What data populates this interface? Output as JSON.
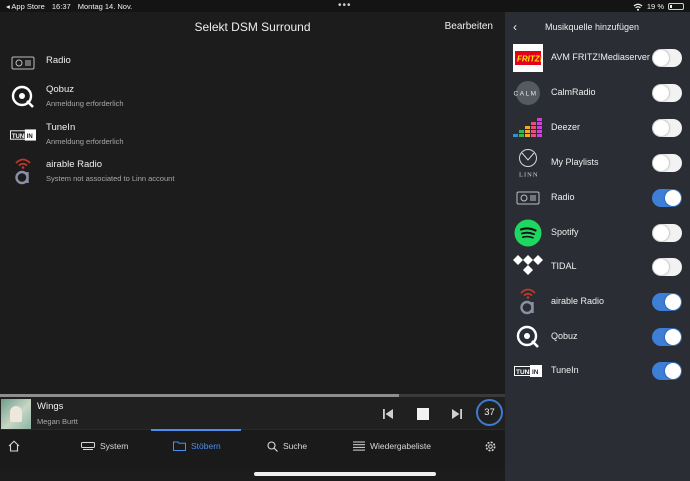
{
  "status_bar": {
    "back_app": "◂ App Store",
    "time": "16:37",
    "date": "Montag 14. Nov.",
    "battery": "19 %",
    "battery_level": 0.19
  },
  "main": {
    "title": "Selekt DSM Surround",
    "edit_label": "Bearbeiten",
    "sources": [
      {
        "name": "Radio",
        "subtitle": "",
        "icon": "radio-icon"
      },
      {
        "name": "Qobuz",
        "subtitle": "Anmeldung erforderlich",
        "icon": "qobuz-icon"
      },
      {
        "name": "TuneIn",
        "subtitle": "Anmeldung erforderlich",
        "icon": "tunein-icon"
      },
      {
        "name": "airable Radio",
        "subtitle": "System not associated to Linn account",
        "icon": "airable-icon"
      }
    ]
  },
  "player": {
    "track": "Wings",
    "artist": "Megan Burtt",
    "volume": "37",
    "progress": 0.79
  },
  "tabs": [
    {
      "label": "",
      "icon": "home-icon"
    },
    {
      "label": "System",
      "icon": "system-icon"
    },
    {
      "label": "Stöbern",
      "icon": "browse-icon",
      "active": true
    },
    {
      "label": "Suche",
      "icon": "search-icon"
    },
    {
      "label": "Wiedergabeliste",
      "icon": "playlist-icon"
    },
    {
      "label": "",
      "icon": "gear-icon"
    }
  ],
  "sidebar": {
    "back": "‹",
    "title": "Musikquelle hinzufügen",
    "items": [
      {
        "label": "AVM FRITZ!Mediaserver",
        "enabled": false,
        "icon": "fritz-icon"
      },
      {
        "label": "CalmRadio",
        "enabled": false,
        "icon": "calm-icon"
      },
      {
        "label": "Deezer",
        "enabled": false,
        "icon": "deezer-icon"
      },
      {
        "label": "My Playlists",
        "enabled": false,
        "icon": "linn-icon"
      },
      {
        "label": "Radio",
        "enabled": true,
        "icon": "radio-icon"
      },
      {
        "label": "Spotify",
        "enabled": false,
        "icon": "spotify-icon"
      },
      {
        "label": "TIDAL",
        "enabled": false,
        "icon": "tidal-icon"
      },
      {
        "label": "airable Radio",
        "enabled": true,
        "icon": "airable-icon"
      },
      {
        "label": "Qobuz",
        "enabled": true,
        "icon": "qobuz-icon"
      },
      {
        "label": "TuneIn",
        "enabled": true,
        "icon": "tunein-icon"
      }
    ]
  },
  "colors": {
    "accent": "#4a8ef0",
    "toggle_on": "#3d7ed6",
    "panel": "#2a2d33",
    "background": "#1c1c1c"
  }
}
